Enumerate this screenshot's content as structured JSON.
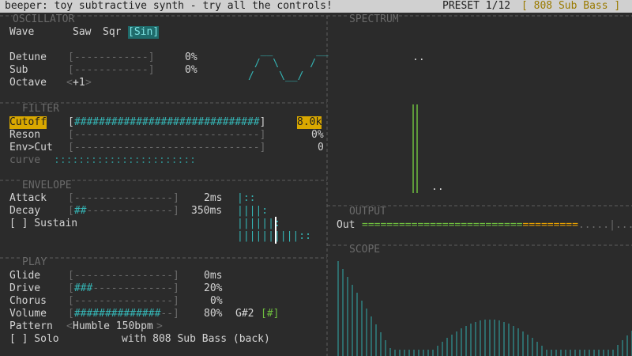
{
  "title_bar": {
    "title": "beeper: toy subtractive synth - try all the controls!",
    "preset_label": "PRESET 1/12",
    "preset_name": "[ 808 Sub Bass ]"
  },
  "sections": {
    "oscillator": "OSCILLATOR",
    "filter": "FILTER",
    "envelope": "ENVELOPE",
    "play": "PLAY",
    "spectrum": "SPECTRUM",
    "output": "OUTPUT",
    "scope": "SCOPE"
  },
  "oscillator": {
    "wave_label": "Wave",
    "wave_options": [
      "Saw",
      "Sqr",
      "[Sin]"
    ],
    "detune": {
      "label": "Detune",
      "bar": "[------------]",
      "value": "0%"
    },
    "sub": {
      "label": "Sub",
      "bar": "[------------]",
      "value": "0%"
    },
    "octave": {
      "label": "Octave",
      "left": "<",
      "value": "+1",
      "right": ">"
    },
    "wave_art": [
      "  __       __",
      " /  \\     /",
      "/    \\__/"
    ]
  },
  "filter": {
    "cutoff": {
      "label": "Cutoff",
      "bar_open": "[",
      "bar_fill": "##############################",
      "bar_close": "]",
      "value": "8.0k"
    },
    "reson": {
      "label": "Reson",
      "bar": "[------------------------------]",
      "value": "0%"
    },
    "envcut": {
      "label": "Env>Cut",
      "bar": "[------------------------------]",
      "value": "0"
    },
    "curve_label": "curve",
    "curve": ":::::::::::::::::::::::"
  },
  "envelope": {
    "attack": {
      "label": "Attack",
      "bar": "[----------------]",
      "value": "2ms"
    },
    "decay": {
      "label": "Decay",
      "bar_open": "[",
      "bar_fill": "##",
      "bar_rest": "--------------]",
      "value": "350ms"
    },
    "sustain": {
      "label": "[ ] Sustain"
    },
    "art": [
      "|::",
      "||||:",
      "||||||:",
      "||||||||||::"
    ]
  },
  "play": {
    "glide": {
      "label": "Glide",
      "bar": "[----------------]",
      "value": "0ms"
    },
    "drive": {
      "label": "Drive",
      "bar_open": "[",
      "bar_fill": "###",
      "bar_rest": "-------------]",
      "value": "20%"
    },
    "chorus": {
      "label": "Chorus",
      "bar": "[----------------]",
      "value": "0%"
    },
    "volume": {
      "label": "Volume",
      "bar_open": "[",
      "bar_fill": "##############",
      "bar_rest": "--]",
      "value": "80%"
    },
    "note": "G#2",
    "note_tag": "[#]",
    "pattern": {
      "label": "Pattern",
      "left": "<",
      "value": "Humble 150bpm",
      "right": ">"
    },
    "solo": "[ ] Solo",
    "with_text": "with 808 Sub Bass (back)"
  },
  "spectrum": {
    "dots_top": "..",
    "dots_bottom": ".."
  },
  "output": {
    "label": "Out",
    "meter_green": "==========================",
    "meter_orange": "=========",
    "meter_tail": ".....|....."
  },
  "colors": {
    "accent": "#35b5b5",
    "highlight": "#d9a800",
    "meter_green": "#6fbf3f",
    "bg": "#2b2b2b"
  }
}
